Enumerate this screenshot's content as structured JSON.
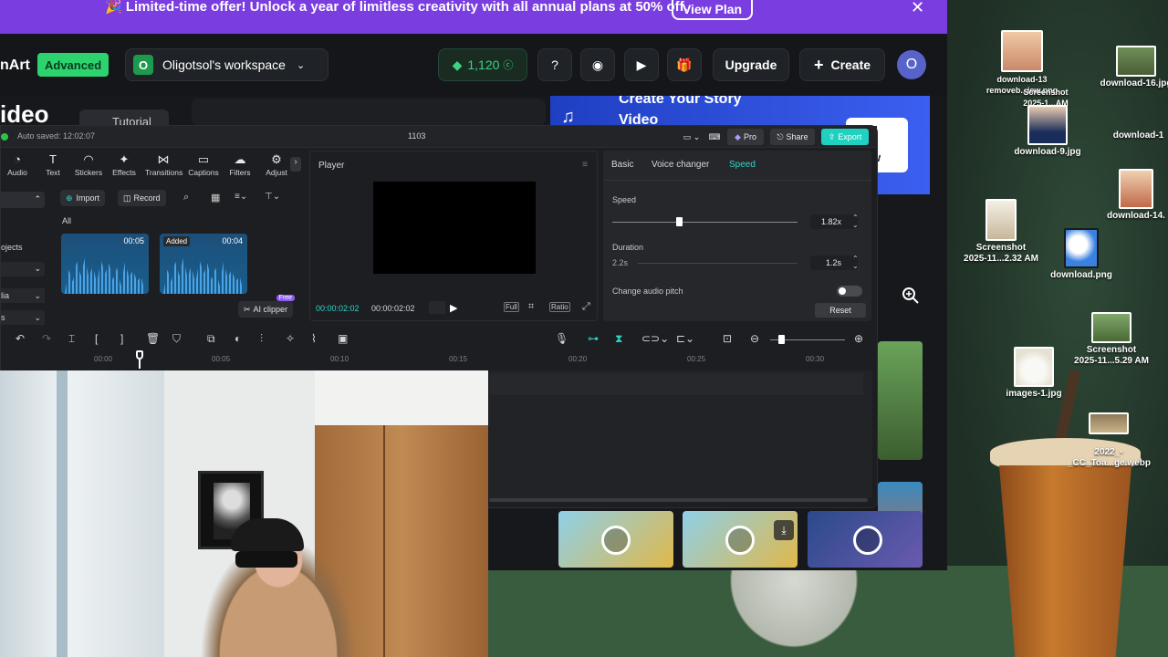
{
  "banner": {
    "text": "🎉 Limited-time offer! Unlock a year of limitless creativity with all annual plans at 50% off.",
    "cta": "View Plan"
  },
  "header": {
    "brand": "nArt",
    "plan_badge": "Advanced",
    "workspace_initial": "O",
    "workspace_name": "Oligotsol's workspace",
    "credits": "1,120",
    "upgrade": "Upgrade",
    "create": "Create",
    "avatar_initial": "O"
  },
  "background_page": {
    "title_fragment": "ideo",
    "tutorial": "Tutorial",
    "promo_line1": "Create Your Story",
    "promo_line2": "Video",
    "promo_btn_fragment": "w"
  },
  "editor": {
    "autosave": "Auto saved: 12:02:07",
    "project_name": "1103",
    "pro": "Pro",
    "share": "Share",
    "export": "Export",
    "tools": [
      "Audio",
      "Text",
      "Stickers",
      "Effects",
      "Transitions",
      "Captions",
      "Filters",
      "Adjust"
    ],
    "tool_icons": [
      "audio-icon",
      "text-icon",
      "stickers-icon",
      "effects-icon",
      "transitions-icon",
      "captions-icon",
      "filters-icon",
      "adjust-icon"
    ],
    "import": "Import",
    "record": "Record",
    "filter_all": "All",
    "left_items": [
      "ojects",
      "lia",
      "s"
    ],
    "clips": [
      {
        "duration": "00:05",
        "added": ""
      },
      {
        "duration": "00:04",
        "added": "Added"
      }
    ],
    "ai_clipper": "AI clipper",
    "free_badge": "Free",
    "player": {
      "title": "Player",
      "current": "00:00:02:02",
      "total": "00:00:02:02",
      "full": "Full",
      "ratio": "Ratio"
    },
    "props": {
      "tabs": [
        "Basic",
        "Voice changer",
        "Speed"
      ],
      "active_tab": "Speed",
      "speed_label": "Speed",
      "speed_value": "1.82x",
      "duration_label": "Duration",
      "duration_from": "2.2s",
      "duration_value": "1.2s",
      "pitch_label": "Change audio pitch",
      "reset": "Reset"
    },
    "ruler": [
      "00:00",
      "00:05",
      "00:10",
      "00:15",
      "00:20",
      "00:25",
      "00:30"
    ]
  },
  "desktop": {
    "icons": [
      {
        "label": "download-13\nremovebg-preview.png",
        "name": "desktop-icon-download-13"
      },
      {
        "label": "Screenshot\n2025-1...AM",
        "name": "desktop-icon-screenshot-a"
      },
      {
        "label": "download-16.jpg",
        "name": "desktop-icon-download-16"
      },
      {
        "label": "download-9.jpg",
        "name": "desktop-icon-download-9"
      },
      {
        "label": "download-1",
        "name": "desktop-icon-download-1"
      },
      {
        "label": "download-14.",
        "name": "desktop-icon-download-14"
      },
      {
        "label": "Screenshot\n2025-11...2.32 AM",
        "name": "desktop-icon-screenshot-b"
      },
      {
        "label": "download.png",
        "name": "desktop-icon-download"
      },
      {
        "label": "Screenshot\n2025-11...5.29 AM",
        "name": "desktop-icon-screenshot-c"
      },
      {
        "label": "images-1.jpg",
        "name": "desktop-icon-images-1"
      },
      {
        "label": "2022_-\n_CC_Toa...ge.webp",
        "name": "desktop-icon-2022-cc"
      }
    ]
  },
  "colors": {
    "accent": "#2fd6c6",
    "banner": "#7a3de0",
    "badge": "#2dd36f",
    "export": "#1fd1c1",
    "promo": "#2f4fe0"
  }
}
